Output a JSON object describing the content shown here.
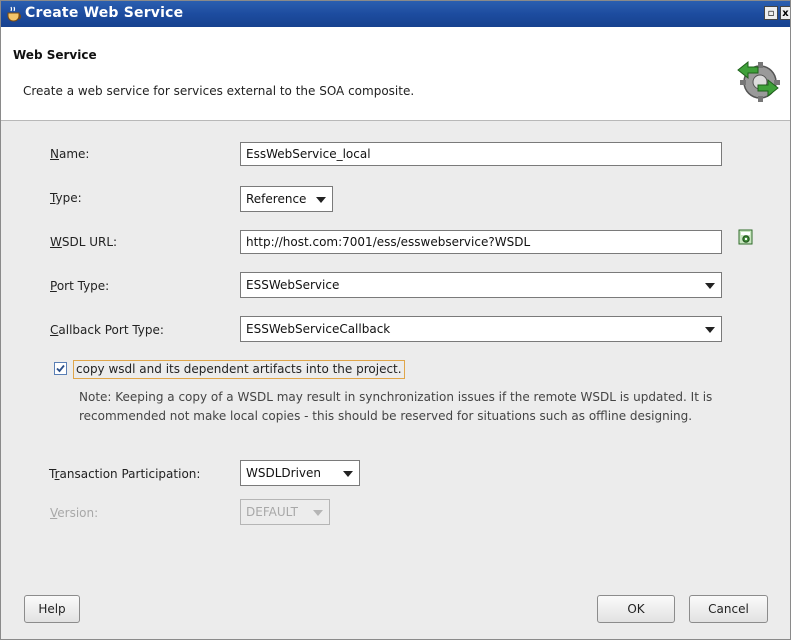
{
  "window": {
    "title": "Create Web Service"
  },
  "header": {
    "title": "Web Service",
    "description": "Create a web service for services external to the SOA composite."
  },
  "form": {
    "name": {
      "label_mnemonic": "N",
      "label_rest": "ame:",
      "value": "EssWebService_local"
    },
    "type": {
      "label_mnemonic": "T",
      "label_rest": "ype:",
      "value": "Reference"
    },
    "wsdl_url": {
      "label_mnemonic": "W",
      "label_rest": "SDL URL:",
      "value": "http://host.com:7001/ess/esswebservice?WSDL"
    },
    "port_type": {
      "label_mnemonic": "P",
      "label_rest": "ort Type:",
      "value": "ESSWebService"
    },
    "callback_port_type": {
      "label_mnemonic": "C",
      "label_rest": "allback Port Type:",
      "value": "ESSWebServiceCallback"
    },
    "copy_wsdl": {
      "checked": true,
      "label": "copy wsdl and its dependent artifacts into the project."
    },
    "note": "Note: Keeping a copy of a WSDL may result in synchronization issues if the remote WSDL is updated. It is recommended not make local copies - this should be reserved for situations such as offline designing.",
    "transaction": {
      "label_pre": "T",
      "label_mnemonic": "r",
      "label_rest": "ansaction Participation:",
      "value": "WSDLDriven"
    },
    "version": {
      "label_mnemonic": "V",
      "label_rest": "ersion:",
      "value": "DEFAULT",
      "disabled": true
    }
  },
  "buttons": {
    "help": "Help",
    "ok": "OK",
    "cancel": "Cancel"
  },
  "icons": {
    "title_icon": "cup-icon",
    "header_icon": "service-gear-icon",
    "wsdl_browse": "find-wsdl-icon",
    "restore": "restore-icon",
    "close": "close-icon"
  },
  "colors": {
    "titlebar": "#1d4c9f",
    "checkbox_focus": "#e0a64a"
  }
}
